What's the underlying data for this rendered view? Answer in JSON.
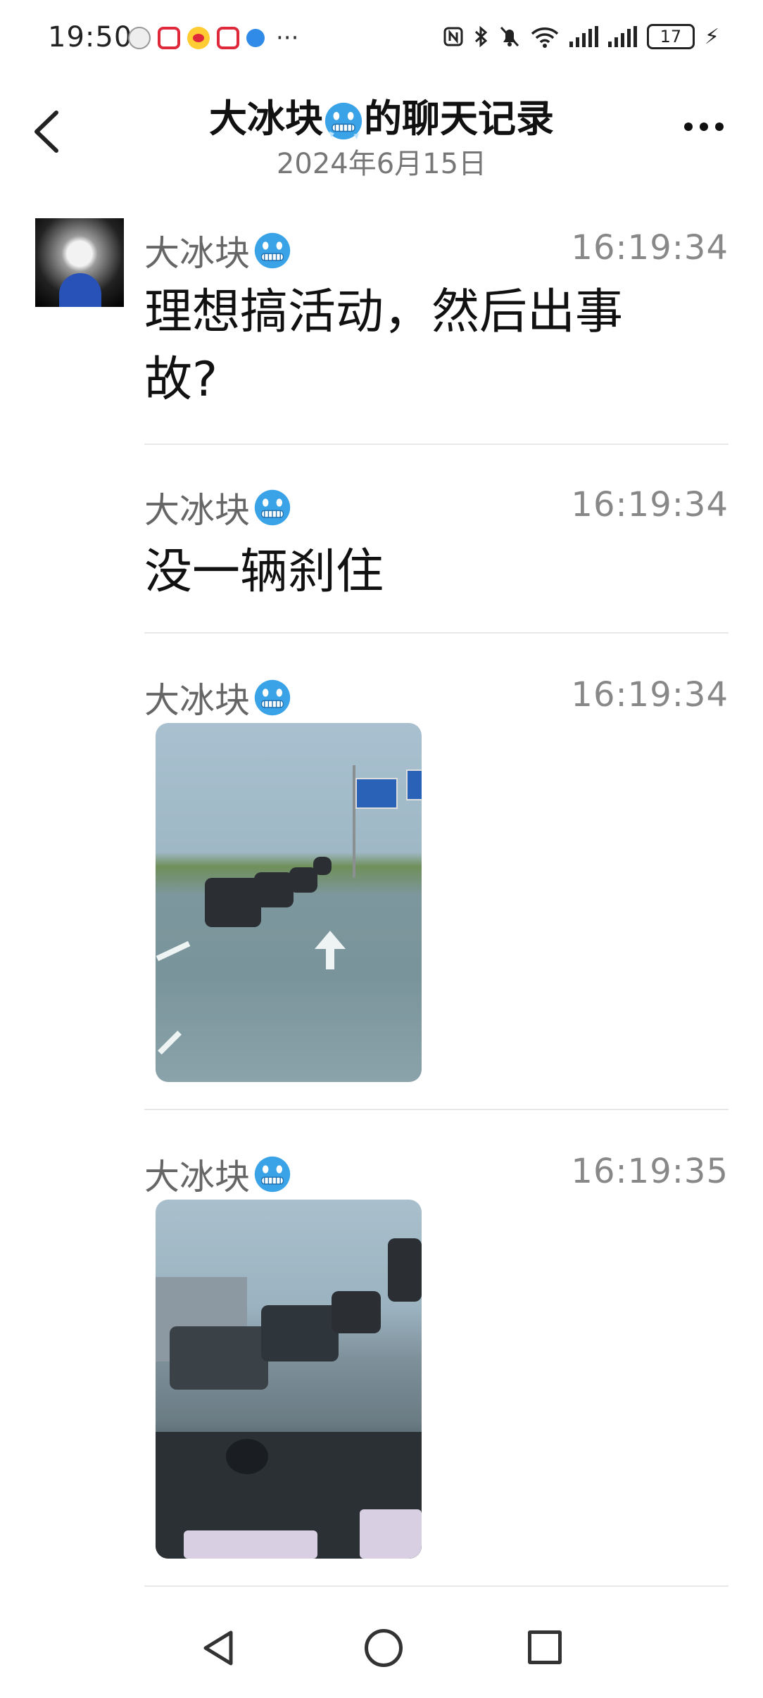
{
  "status_bar": {
    "time": "19:50",
    "more_glyph": "···",
    "battery": "17",
    "icons": [
      "app-ghost-icon",
      "app-red-icon",
      "weibo-icon",
      "app-red-icon",
      "app-blue-icon",
      "nfc-icon",
      "bluetooth-icon",
      "mute-icon",
      "wifi-icon",
      "signal-icon",
      "signal-icon",
      "battery-icon",
      "charging-icon"
    ]
  },
  "header": {
    "title_prefix": "大冰块",
    "title_suffix": "的聊天记录",
    "date": "2024年6月15日",
    "back_icon": "chevron-left-icon",
    "more_icon": "more-dots-icon"
  },
  "messages": [
    {
      "sender": "大冰块",
      "time": "16:19:34",
      "type": "text",
      "text": "理想搞活动，然后出事故?"
    },
    {
      "sender": "大冰块",
      "time": "16:19:34",
      "type": "text",
      "text": "没一辆刹住"
    },
    {
      "sender": "大冰块",
      "time": "16:19:34",
      "type": "image"
    },
    {
      "sender": "大冰块",
      "time": "16:19:35",
      "type": "image"
    }
  ],
  "colors": {
    "background": "#ffffff",
    "secondary_text": "#777777",
    "divider": "#e8e8e8",
    "emoji_face": "#3aa3e8"
  },
  "nav": {
    "icons": [
      "nav-back-icon",
      "nav-home-icon",
      "nav-recents-icon"
    ]
  }
}
